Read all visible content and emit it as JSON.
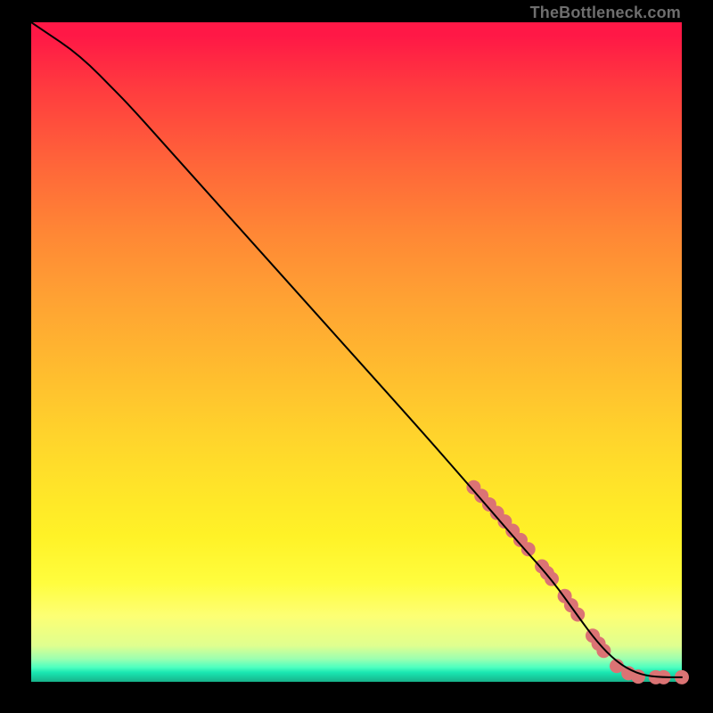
{
  "attribution": "TheBottleneck.com",
  "chart_data": {
    "type": "line",
    "title": "",
    "xlabel": "",
    "ylabel": "",
    "xlim": [
      0,
      100
    ],
    "ylim": [
      0,
      100
    ],
    "grid": false,
    "legend": false,
    "series": [
      {
        "name": "curve",
        "color": "#000000",
        "stroke_width": 2,
        "x": [
          0,
          3,
          6,
          9,
          12,
          15,
          20,
          30,
          40,
          50,
          60,
          68,
          75,
          80,
          84,
          87,
          90,
          93,
          96,
          100
        ],
        "y": [
          100,
          98,
          96,
          93.5,
          90.5,
          87.5,
          82,
          71,
          60,
          49,
          38,
          29,
          21,
          15.5,
          10,
          6,
          3,
          1.3,
          0.7,
          0.7
        ]
      }
    ],
    "markers": [
      {
        "name": "dashes",
        "color": "#db7374",
        "radius": 8,
        "points": [
          {
            "x": 68.0,
            "y": 29.5
          },
          {
            "x": 69.2,
            "y": 28.2
          },
          {
            "x": 70.4,
            "y": 26.9
          },
          {
            "x": 71.6,
            "y": 25.6
          },
          {
            "x": 72.8,
            "y": 24.3
          },
          {
            "x": 74.0,
            "y": 22.9
          },
          {
            "x": 75.2,
            "y": 21.5
          },
          {
            "x": 76.4,
            "y": 20.1
          },
          {
            "x": 78.5,
            "y": 17.5
          },
          {
            "x": 79.3,
            "y": 16.5
          },
          {
            "x": 80.0,
            "y": 15.6
          },
          {
            "x": 82.0,
            "y": 13.0
          },
          {
            "x": 83.0,
            "y": 11.6
          },
          {
            "x": 84.0,
            "y": 10.2
          },
          {
            "x": 86.3,
            "y": 7.0
          },
          {
            "x": 87.2,
            "y": 5.8
          },
          {
            "x": 88.0,
            "y": 4.7
          },
          {
            "x": 90.0,
            "y": 2.4
          },
          {
            "x": 91.8,
            "y": 1.3
          },
          {
            "x": 93.3,
            "y": 0.8
          },
          {
            "x": 96.0,
            "y": 0.7
          },
          {
            "x": 97.2,
            "y": 0.7
          },
          {
            "x": 100.0,
            "y": 0.7
          }
        ]
      }
    ]
  }
}
